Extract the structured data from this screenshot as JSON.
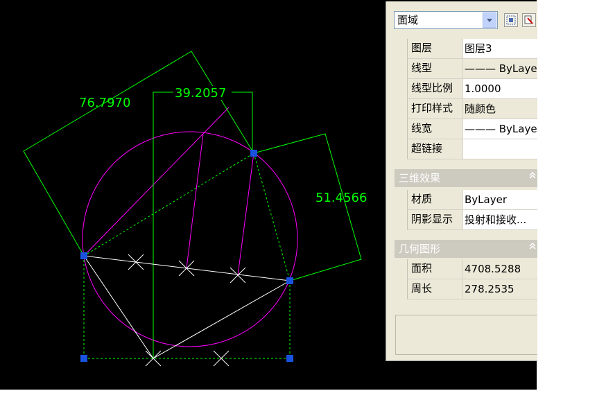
{
  "drawing": {
    "dimensions": [
      "76.7970",
      "39.2057",
      "51.4566"
    ]
  },
  "palette": {
    "object_type": "面域",
    "general": [
      {
        "key": "图层",
        "value": "图层3"
      },
      {
        "key": "线型",
        "value": "——— ByLayer"
      },
      {
        "key": "线型比例",
        "value": "1.0000"
      },
      {
        "key": "打印样式",
        "value": "随颜色"
      },
      {
        "key": "线宽",
        "value": "——— ByLayer"
      },
      {
        "key": "超链接",
        "value": ""
      }
    ],
    "section_3d": {
      "title": "三维效果",
      "rows": [
        {
          "key": "材质",
          "value": "ByLayer"
        },
        {
          "key": "阴影显示",
          "value": "投射和接收..."
        }
      ]
    },
    "section_geometry": {
      "title": "几何图形",
      "rows": [
        {
          "key": "面积",
          "value": "4708.5288"
        },
        {
          "key": "周长",
          "value": "278.2535"
        }
      ]
    }
  },
  "colors": {
    "canvas": "#000000",
    "dimension": "#00ff00",
    "circle": "#ff00ff",
    "grip": "#1a52e0"
  }
}
